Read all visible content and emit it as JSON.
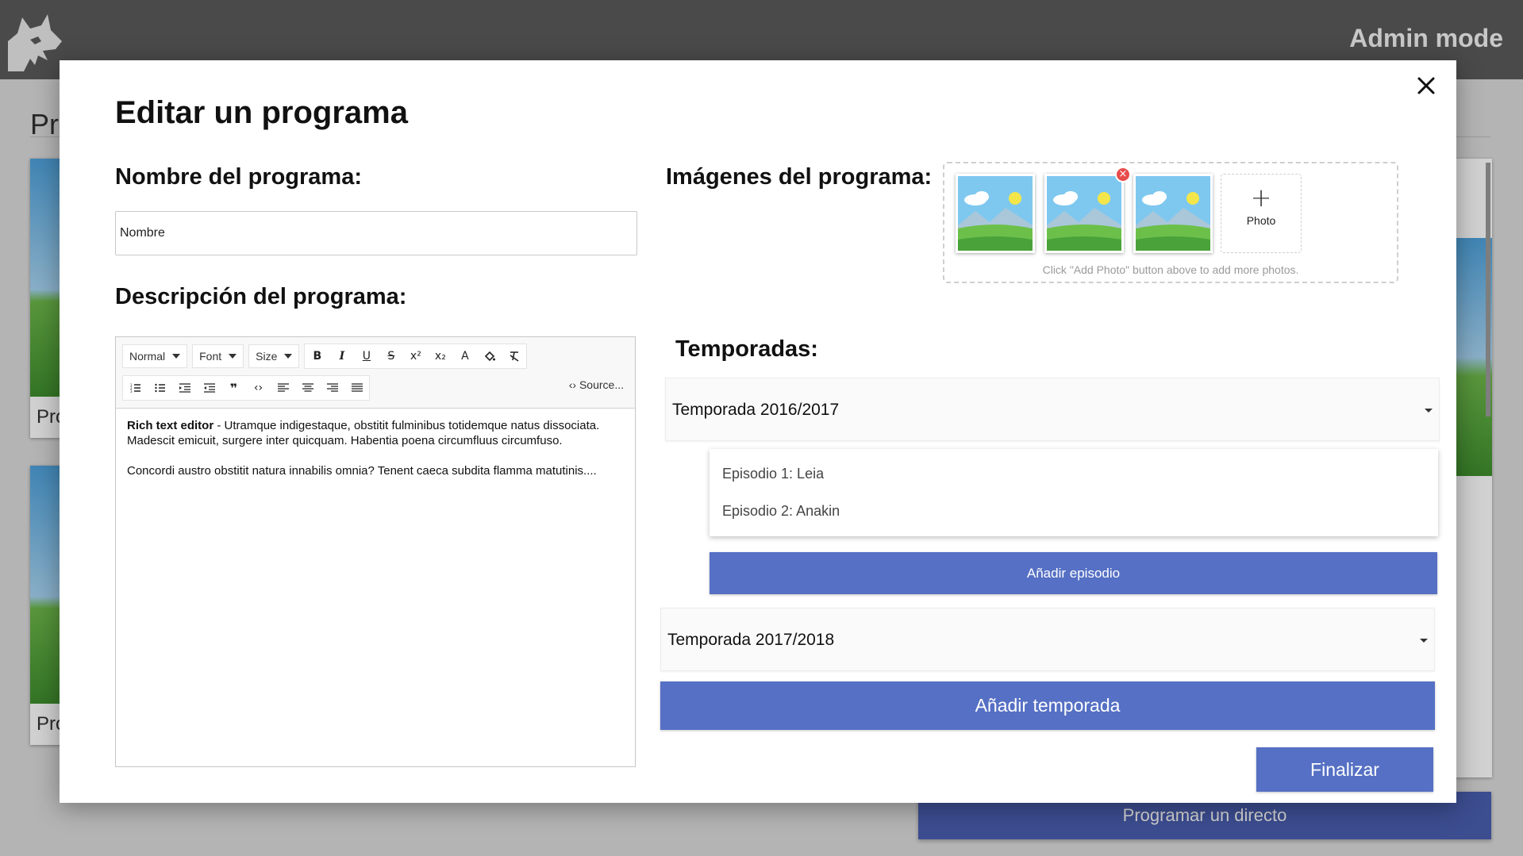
{
  "app": {
    "mode_label": "Admin mode",
    "bg_heading": "Pr",
    "bg_cards": [
      "Pro",
      "Pro"
    ],
    "bg_live_button": "Programar un directo"
  },
  "modal": {
    "title": "Editar un programa",
    "name_label": "Nombre del programa:",
    "name_value": "Nombre",
    "description_label": "Descripción del programa:",
    "images_label": "Imágenes del programa:",
    "seasons_label": "Temporadas:",
    "finish_button": "Finalizar"
  },
  "editor": {
    "format_dropdown": "Normal",
    "font_dropdown": "Font",
    "size_dropdown": "Size",
    "source_button": "Source...",
    "content_bold": "Rich text editor",
    "content_rest": " - Utramque indigestaque, obstitit fulminibus totidemque natus dissociata. Madescit emicuit, surgere inter quicquam. Habentia poena circumfluus circumfuso.",
    "content_p2": "Concordi austro obstitit natura innabilis omnia? Tenent caeca subdita flamma matutinis...."
  },
  "images": {
    "count": 3,
    "add_photo_label": "Photo",
    "hint": "Click \"Add Photo\" button above to add more photos."
  },
  "seasons": [
    {
      "title": "Temporada 2016/2017",
      "episodes": [
        "Episodio 1: Leia",
        "Episodio 2: Anakin"
      ],
      "add_episode_label": "Añadir episodio"
    },
    {
      "title": "Temporada 2017/2018"
    }
  ],
  "add_season_label": "Añadir temporada",
  "colors": {
    "primary": "#5570c4",
    "topbar": "#5b5b5b",
    "remove_badge": "#e84b4b"
  }
}
